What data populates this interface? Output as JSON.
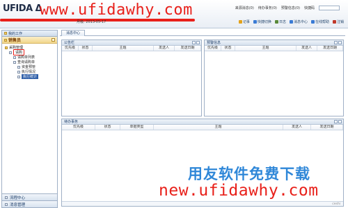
{
  "header": {
    "logo": "UFIDA",
    "logo_suffix": "Δ",
    "watermark_url": "www.ufidawhy.com",
    "user_info": "月级: 2013-05-17",
    "nav": {
      "item1": "来源消息(0)",
      "item2": "待办事务(0)",
      "item3": "预警信息(0)",
      "quick_label": "快捷码"
    },
    "toolbar": [
      {
        "label": "记事",
        "icon": "bulb-icon",
        "color": "#e3a21a"
      },
      {
        "label": "快捷切换",
        "icon": "switch-icon",
        "color": "#3a7bd5"
      },
      {
        "label": "日志",
        "icon": "log-icon",
        "color": "#5a8a3a"
      },
      {
        "label": "消息中心",
        "icon": "message-icon",
        "color": "#3a7bd5"
      },
      {
        "label": "在线帮助",
        "icon": "help-icon",
        "color": "#3a7bd5"
      },
      {
        "label": "注销",
        "icon": "logout-icon",
        "color": "#c0392b"
      }
    ]
  },
  "sidebar": {
    "header": "我的工作",
    "user_block": "销售员",
    "tree": [
      {
        "label": "采购管理",
        "level": 1,
        "icon": "folder"
      },
      {
        "label": "请购",
        "level": 2,
        "icon": "doc",
        "circled": true
      },
      {
        "label": "请购单列表",
        "level": 3,
        "icon": "doc"
      },
      {
        "label": "查询请购单",
        "level": 3,
        "icon": "doc"
      },
      {
        "label": "资金预管",
        "level": 4,
        "icon": "doc"
      },
      {
        "label": "执行情况",
        "level": 4,
        "icon": "doc"
      },
      {
        "label": "执行统计",
        "level": 4,
        "icon": "doc",
        "selected": true
      }
    ],
    "bottom": [
      {
        "label": "流程中心"
      },
      {
        "label": "消息管理"
      }
    ]
  },
  "main": {
    "tab": "消息中心",
    "announcements": {
      "title": "公告栏",
      "columns": [
        "优先级",
        "状态",
        "主题",
        "发送人",
        "发送日期"
      ]
    },
    "alerts": {
      "title": "预警信息",
      "columns": [
        "优先级",
        "状态",
        "主题",
        "发送人",
        "发送日期"
      ]
    },
    "tasks": {
      "title": "待办事务",
      "columns": [
        "优先级",
        "状态",
        "单据类型",
        "主题",
        "发送人",
        "发送日期"
      ],
      "footer": "ceshi"
    }
  },
  "watermark": {
    "cn": "用友软件免费下载",
    "url": "new.ufidawhy.com"
  }
}
